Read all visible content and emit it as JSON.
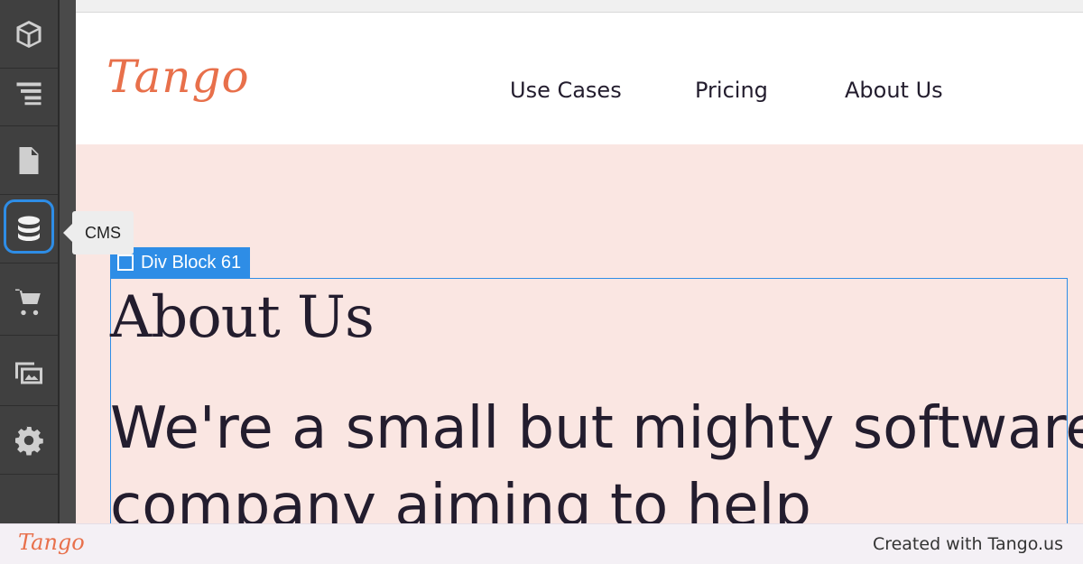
{
  "toolbar": {
    "items": [
      {
        "icon": "cube-icon"
      },
      {
        "icon": "navigator-icon"
      },
      {
        "icon": "pages-icon"
      },
      {
        "icon": "cms-database-icon",
        "active": true
      },
      {
        "icon": "cart-icon"
      },
      {
        "icon": "assets-icon"
      },
      {
        "icon": "gear-icon"
      }
    ],
    "tooltip": "CMS"
  },
  "site": {
    "logo": "Tango",
    "nav": [
      "Use Cases",
      "Pricing",
      "About Us"
    ],
    "selection_label": "Div Block 61",
    "heading": "About Us",
    "body": "We're a small but mighty software company aiming to help"
  },
  "footer": {
    "logo": "Tango",
    "credit": "Created with Tango.us"
  },
  "colors": {
    "accent": "#2e8de6",
    "brand": "#e8704b",
    "canvas_bg": "#fae6e2",
    "text": "#231d2e"
  }
}
